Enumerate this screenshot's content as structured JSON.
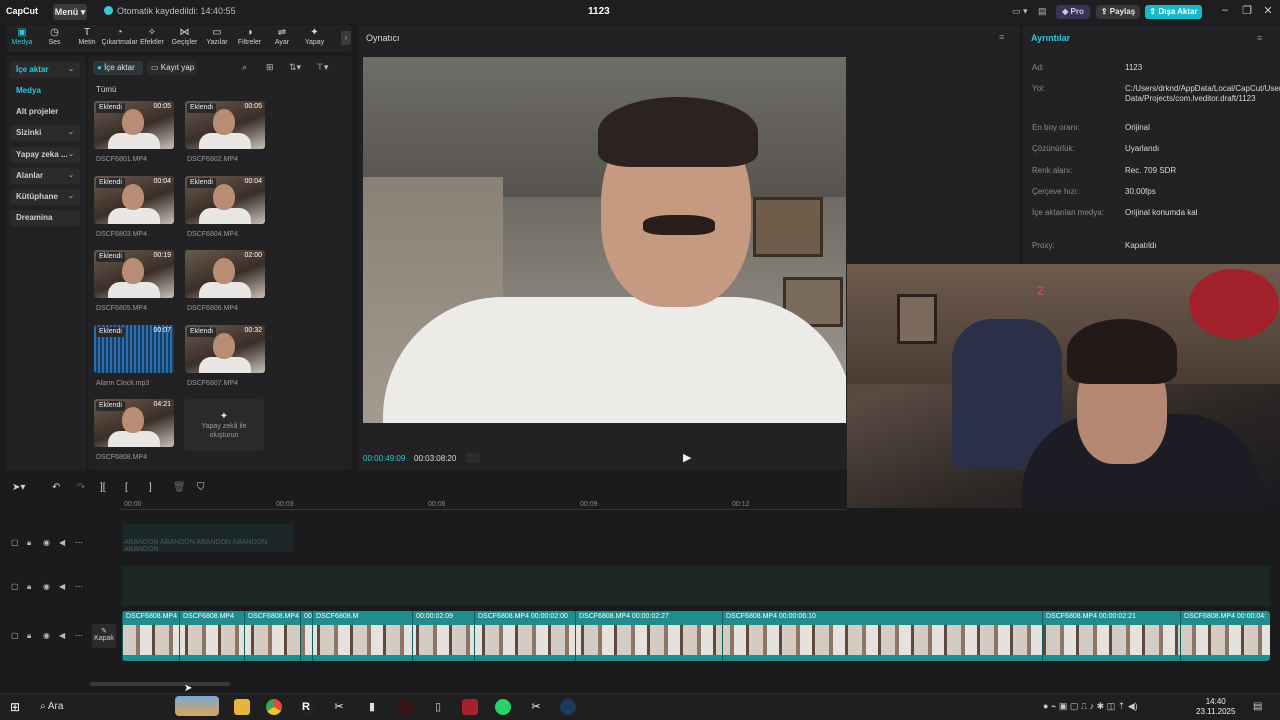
{
  "app": {
    "logo": "CapCut",
    "menu_label": "Menü",
    "autosave": "Otomatik kaydedildi: 14:40:55",
    "project_title": "1123",
    "pro_label": "Pro",
    "share_label": "Paylaş",
    "export_label": "Dışa Aktar"
  },
  "toolbar": {
    "tabs": [
      {
        "label": "Medya",
        "icon": "media-icon"
      },
      {
        "label": "Ses",
        "icon": "audio-icon"
      },
      {
        "label": "Metin",
        "icon": "text-icon"
      },
      {
        "label": "Çıkartmalar",
        "icon": "sticker-icon"
      },
      {
        "label": "Efektler",
        "icon": "effects-icon"
      },
      {
        "label": "Geçişler",
        "icon": "transitions-icon"
      },
      {
        "label": "Yazılar",
        "icon": "captions-icon"
      },
      {
        "label": "Filtreler",
        "icon": "filters-icon"
      },
      {
        "label": "Ayar",
        "icon": "adjust-icon"
      },
      {
        "label": "Yapay",
        "icon": "ai-icon"
      }
    ]
  },
  "sidebar": {
    "items": [
      {
        "label": "İçe aktar",
        "boxed": true,
        "chevron": true,
        "active": true
      },
      {
        "label": "Medya",
        "boxed": false,
        "chevron": false,
        "active": true
      },
      {
        "label": "Alt projeler",
        "boxed": false,
        "chevron": false,
        "active": false
      },
      {
        "label": "Sizinki",
        "boxed": true,
        "chevron": true,
        "active": false
      },
      {
        "label": "Yapay zeka ...",
        "boxed": true,
        "chevron": true,
        "active": false
      },
      {
        "label": "Alanlar",
        "boxed": true,
        "chevron": true,
        "active": false
      },
      {
        "label": "Kütüphane",
        "boxed": true,
        "chevron": true,
        "active": false
      },
      {
        "label": "Dreamina",
        "boxed": true,
        "chevron": false,
        "active": false
      }
    ]
  },
  "media": {
    "import_label": "İçe aktar",
    "record_label": "Kayıt yap",
    "filter_all": "Tümü",
    "items": [
      {
        "badge": "Eklendi",
        "duration": "00:05",
        "name": "DSCF6801.MP4"
      },
      {
        "badge": "Eklendi",
        "duration": "00:05",
        "name": "DSCF6802.MP4"
      },
      {
        "badge": "Eklendi",
        "duration": "00:04",
        "name": "DSCF6803.MP4"
      },
      {
        "badge": "Eklendi",
        "duration": "00:04",
        "name": "DSCF6804.MP4"
      },
      {
        "badge": "Eklendi",
        "duration": "00:19",
        "name": "DSCF6805.MP4"
      },
      {
        "badge": "",
        "duration": "02:00",
        "name": "DSCF6806.MP4"
      },
      {
        "badge": "Eklendi",
        "duration": "00:07",
        "name": "Alarm Clock.mp3"
      },
      {
        "badge": "Eklendi",
        "duration": "00:32",
        "name": "DSCF6807.MP4"
      },
      {
        "badge": "Eklendi",
        "duration": "04:21",
        "name": "DSCF6808.MP4"
      }
    ],
    "ai_create_label": "Yapay zekâ ile oluşturun"
  },
  "player": {
    "title": "Oynatıcı",
    "current_time": "00:00:49:09",
    "total_time": "00:03:08:20"
  },
  "details": {
    "title": "Ayrıntılar",
    "rows": [
      {
        "key": "Ad:",
        "value": "1123"
      },
      {
        "key": "Yol:",
        "value": "C:/Users/drknd/AppData/Local/CapCut/User Data/Projects/com.lveditor.draft/1123"
      },
      {
        "key": "En boy oranı:",
        "value": "Orijinal"
      },
      {
        "key": "Çözünürlük:",
        "value": "Uyarlandı"
      },
      {
        "key": "Renk alanı:",
        "value": "Rec. 709 SDR"
      },
      {
        "key": "Çerçeve hızı:",
        "value": "30.00fps"
      },
      {
        "key": "İçe aktarılan medya:",
        "value": "Orijinal konumda kal"
      },
      {
        "key": "Proxy:",
        "value": "Kapatıldı"
      }
    ]
  },
  "timeline": {
    "ruler_ticks": [
      "00:00",
      "00:03",
      "00:06",
      "00:09",
      "00:12"
    ],
    "cover_label": "Kapak",
    "clips": [
      {
        "label": "DSCF6808.MP4"
      },
      {
        "label": "DSCF6808.MP4"
      },
      {
        "label": "DSCF6808.MP4"
      },
      {
        "label": "00"
      },
      {
        "label": "DSCF6808.M"
      },
      {
        "label": "00:00:02:09"
      },
      {
        "label": "DSCF6808.MP4  00:00:02:00"
      },
      {
        "label": "DSCF6808.MP4  00:00:02:27"
      },
      {
        "label": "DSCF6808.MP4  00:00:06:10"
      },
      {
        "label": "DSCF6808.MP4  00:00:02:21"
      },
      {
        "label": "DSCF6808.MP4  00:00:04:"
      }
    ],
    "faint_text": "ABANDON ABANDON ABANDON ABANDON ABANDON"
  },
  "taskbar": {
    "search_label": "Ara",
    "time": "14:40",
    "date": "23.11.2025"
  },
  "colors": {
    "accent": "#2fcad6",
    "export": "#16b9c9",
    "clip": "#1e8d8b"
  }
}
